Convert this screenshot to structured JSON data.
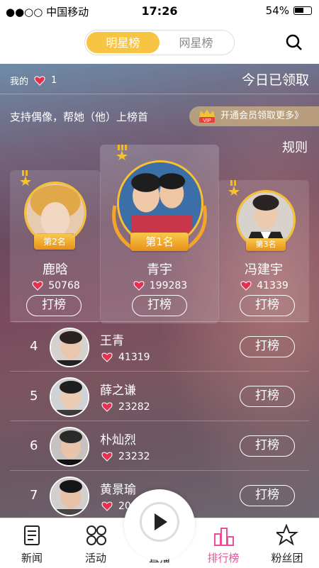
{
  "status": {
    "carrier": "●●○○ 中国移动",
    "time": "17:26",
    "battery": "54%"
  },
  "nav": {
    "tab1": "明星榜",
    "tab2": "网星榜"
  },
  "hero": {
    "my_label": "我的",
    "my_count": "1",
    "claimed": "今日已领取",
    "support": "支持偶像，帮她（他）上榜首",
    "vip": "开通会员领取更多》",
    "vip_badge": "VIP",
    "rules": "规则"
  },
  "top3": [
    {
      "rank": "第2名",
      "name": "鹿晗",
      "score": "50768",
      "button": "打榜"
    },
    {
      "rank": "第1名",
      "name": "青宇",
      "score": "199283",
      "button": "打榜"
    },
    {
      "rank": "第3名",
      "name": "冯建宇",
      "score": "41339",
      "button": "打榜"
    }
  ],
  "list": [
    {
      "num": "4",
      "name": "王青",
      "score": "41319",
      "button": "打榜"
    },
    {
      "num": "5",
      "name": "薛之谦",
      "score": "23282",
      "button": "打榜"
    },
    {
      "num": "6",
      "name": "朴灿烈",
      "score": "23232",
      "button": "打榜"
    },
    {
      "num": "7",
      "name": "黄景瑜",
      "score": "20",
      "button": "打榜"
    }
  ],
  "tabs": {
    "news": "新闻",
    "activity": "活动",
    "live": "直播",
    "rank": "排行榜",
    "fans": "粉丝团"
  },
  "colors": {
    "accent": "#f7c543",
    "active_tab": "#ee4d9a"
  }
}
